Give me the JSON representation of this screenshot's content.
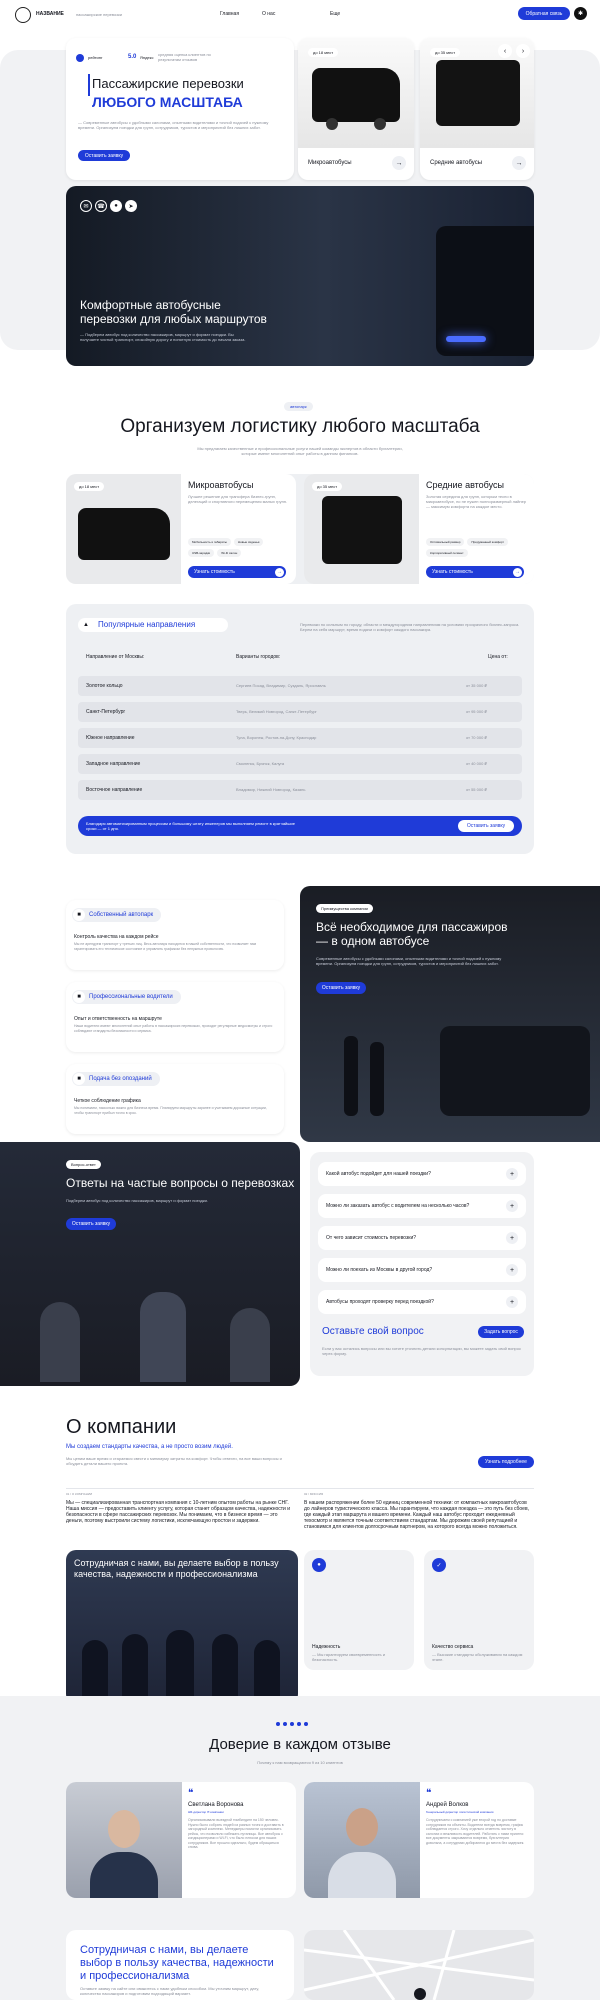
{
  "header": {
    "logo": "НАЗВАНИЕ",
    "tagline": "пассажирские перевозки",
    "nav": [
      "Главная",
      "О нас"
    ],
    "nav3": "Еще",
    "cta": "Обратная связь"
  },
  "hero": {
    "rating_label": "рейтинг",
    "rating": "5.0",
    "rating_src": "Яндекс",
    "rating_note": "средняя оценка клиентов по результатам отзывов",
    "title1": "Пассажирские перевозки",
    "title2": "ЛЮБОГО МАСШТАБА",
    "desc": "— Современные автобусы с удобными салонами, опытными водителями и точной подачей к нужному времени. Организуем поездки для групп, сотрудников, туристов и мероприятий без лишних забот.",
    "cta": "Оставить заявку",
    "cards": [
      {
        "badge": "до 18 мест",
        "name": "Микроавтобусы"
      },
      {
        "badge": "до 35 мест",
        "name": "Средние автобусы"
      }
    ]
  },
  "banner": {
    "title": "Комфортные автобусные перевозки для любых маршрутов",
    "desc": "— Подберем автобус под количество пассажиров, маршрут и формат поездки. Вы получаете чистый транспорт, спокойную дорогу и понятную стоимость до начала заказа."
  },
  "logistics": {
    "tag": "автопарк",
    "title": "Организуем логистику любого масштаба",
    "sub": "Мы предлагаем качественные и профессиональные услуги нашей команды экспертов в области бухгалтерии, которые имеют многолетний опыт работы в данном финансов.",
    "fleet": [
      {
        "badge": "до 18 мест",
        "name": "Микроавтобусы",
        "desc": "Лучшее решение для трансфера бизнес-групп, делегаций и спортивного перемещения малых групп.",
        "chips": [
          "Мобильность и габариты",
          "Новые сиденья",
          "USB-зарядки",
          "Wi-Fi салон"
        ],
        "cta": "Узнать стоимость"
      },
      {
        "badge": "до 35 мест",
        "name": "Средние автобусы",
        "desc": "Золотая середина для групп, которым тесно в микроавтобусе, но не нужен полноразмерный лайнер — максимум комфорта на каждое место.",
        "chips": [
          "Оптимальный размер",
          "Продуманный комфорт",
          "Корпоративный сегмент"
        ],
        "cta": "Узнать стоимость"
      }
    ]
  },
  "routes": {
    "title": "Популярные направления",
    "note": "Перевозки по сильным по городу, области и междугородним направлениям на условиях прозрачного бизнес-запроса. Берем на себя маршрут, время подачи и комфорт каждого пассажира.",
    "cols": [
      "Направление от Москвы:",
      "Варианты городов:",
      "Цена от:"
    ],
    "rows": [
      [
        "Золотое кольцо",
        "Сергиев Посад, Владимир, Суздаль, Ярославль",
        "от 35 000 ₽"
      ],
      [
        "Санкт-Петербург",
        "Тверь, Великий Новгород, Санкт-Петербург",
        "от 95 000 ₽"
      ],
      [
        "Южное направление",
        "Тула, Воронеж, Ростов-на-Дону, Краснодар",
        "от 70 000 ₽"
      ],
      [
        "Западное направление",
        "Смоленск, Брянск, Калуга",
        "от 40 000 ₽"
      ],
      [
        "Восточное направление",
        "Владимир, Нижний Новгород, Казань",
        "от 55 000 ₽"
      ]
    ],
    "footer_text": "Благодаря автоматизированным процессам и большому штату инженеров мы выполняем ремонт в кратчайшие сроки — от 1 дня.",
    "footer_cta": "Оставить заявку"
  },
  "features": [
    {
      "tag": "Собственный автопарк",
      "h": "Контроль качества на каждом рейсе",
      "d": "Мы не арендуем транспорт у третьих лиц. Весь автопарк находится в нашей собственности, что позволяет нам гарантировать его техническое состояние и управлять графиком без ненужных проволочек."
    },
    {
      "tag": "Профессиональные водители",
      "h": "Опыт и ответственность на маршруте",
      "d": "Наши водители имеют многолетний опыт работы в пассажирских перевозках, проходят регулярные медосмотры и строго соблюдают стандарты безопасности и сервиса."
    },
    {
      "tag": "Подача без опозданий",
      "h": "Четкое соблюдение графика",
      "d": "Мы понимаем, насколько важно для бизнеса время. Планируем маршруты заранее и учитываем дорожные ситуации, чтобы транспорт прибыл точно в срок."
    }
  ],
  "advantage": {
    "tag": "Преимущества компании",
    "title": "Всё необходимое для пассажиров — в одном автобусе",
    "desc": "Современные автобусы с удобными салонами, опытными водителями и точной подачей к нужному времени. Организуем поездки для групп, сотрудников, туристов и мероприятий без лишних забот.",
    "cta": "Оставить заявку"
  },
  "faq": {
    "tag": "Вопрос-ответ",
    "title": "Ответы на частые вопросы о перевозках",
    "sub": "Подберем автобус под количество пассажиров, маршрут и формат поездки.",
    "cta": "Оставить заявку",
    "items": [
      "Какой автобус подойдет для нашей поездки?",
      "Можно ли заказать автобус с водителем на несколько часов?",
      "От чего зависит стоимость перевозки?",
      "Можно ли поехать из Москвы в другой город?",
      "Автобусы проходят проверку перед поездкой?"
    ],
    "ask_title": "Оставьте свой вопрос",
    "ask_btn": "Задать вопрос",
    "ask_note": "Если у вас остались вопросы или вы хотите уточнить детали консультации, вы можете задать свой вопрос через форму."
  },
  "about": {
    "title": "О компании",
    "sub": "Мы создаем стандарты качества, а не просто возим людей.",
    "desc": "Мы ценим ваше время и стараемся свести к минимуму затраты на комфорт. Чтобы отвезти, на все ваши вопросы и обсудить детали вашего проекта.",
    "cta": "Узнать подробнее",
    "c1_label": "01 / О КОМПАНИИ",
    "c1": "Мы — специализированная транспортная компания с 10-летним опытом работы на рынке СНГ. Наша миссия — предоставить клиенту услугу, которая станет образцом качества, надежности и безопасности в сфере пассажирских перевозок. Мы понимаем, что в бизнесе время — это деньги, поэтому выстроили систему логистики, исключающую простои и задержки.",
    "c2_label": "02 / МИССИЯ",
    "c2": "В нашем распоряжении более 50 единиц современной техники: от компактных микроавтобусов до лайнеров туристического класса. Мы гарантируем, что каждая поездка — это путь без сбоев, где каждый этап маршрута и вашего времени. Каждый наш автобус проходит ежедневный техосмотр и является точным соответствием стандартам. Мы дорожим своей репутацией и становимся для клиентов долгосрочным партнером, на которого всегда можно положиться.",
    "promo": "Сотрудничая с нами, вы делаете выбор в пользу качества, надежности и профессионализма",
    "f1": "Надежность",
    "f1d": "— Мы гарантируем своевременность и безопасность.",
    "f2": "Качество сервиса",
    "f2d": "— Высокие стандарты обслуживания на каждом этапе."
  },
  "reviews": {
    "title": "Доверие в каждом отзыве",
    "sub": "Почему к нам возвращаются 9 из 10 клиентов",
    "items": [
      {
        "name": "Светлана Воронова",
        "role": "HR-директор IT-компании",
        "text": "Организовывали выездной тимбилдинг на 150 человек. Нужно было собрать людей из разных точек и доставить в загородный комплекс. Менеджеры помогли организовать рейсы, что позволило избежать путаницы. Все автобусы с кондиционерами и Wi-Fi, что было плюсом для наших сотрудников. Все прошло идеально, будем обращаться снова."
      },
      {
        "name": "Андрей Волков",
        "role": "Генеральный директор логистической компании",
        "text": "Сотрудничаем с компанией уже второй год по доставке сотрудников на объекты. Водители всегда вовремя, график соблюдается строго. Хочу отдельно отметить чистоту в салонах и вежливость водителей. Работать с ними приятно: все документы закрываются вовремя, бухгалтерия довольна, а сотрудники добираются до места без задержек."
      }
    ]
  },
  "bottom": {
    "title": "Сотрудничая с нами, вы делаете выбор в пользу качества, надежности и профессионализма",
    "desc": "Оставьте заявку на сайте или свяжитесь с нами удобным способом. Мы уточним маршрут, дату, количество пассажиров и подготовим подходящий вариант."
  }
}
